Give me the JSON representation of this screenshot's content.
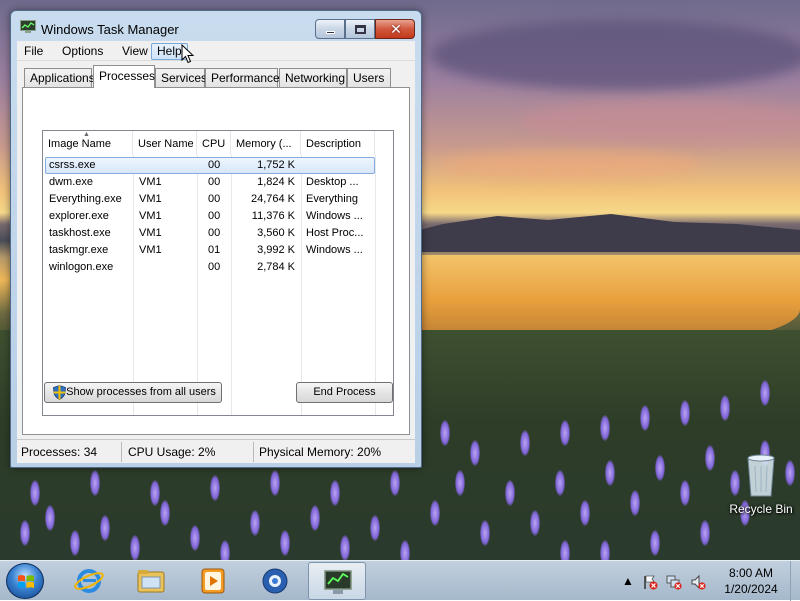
{
  "window": {
    "title": "Windows Task Manager",
    "close_glyph": "✕"
  },
  "menu": {
    "items": [
      "File",
      "Options",
      "View",
      "Help"
    ]
  },
  "tabs": [
    "Applications",
    "Processes",
    "Services",
    "Performance",
    "Networking",
    "Users"
  ],
  "active_tab": "Processes",
  "table": {
    "columns": [
      "Image Name",
      "User Name",
      "CPU",
      "Memory (...",
      "Description"
    ],
    "sort_arrow": "▲",
    "rows": [
      {
        "image": "csrss.exe",
        "user": "",
        "cpu": "00",
        "memory": "1,752 K",
        "description": ""
      },
      {
        "image": "dwm.exe",
        "user": "VM1",
        "cpu": "00",
        "memory": "1,824 K",
        "description": "Desktop ..."
      },
      {
        "image": "Everything.exe",
        "user": "VM1",
        "cpu": "00",
        "memory": "24,764 K",
        "description": "Everything"
      },
      {
        "image": "explorer.exe",
        "user": "VM1",
        "cpu": "00",
        "memory": "11,376 K",
        "description": "Windows ..."
      },
      {
        "image": "taskhost.exe",
        "user": "VM1",
        "cpu": "00",
        "memory": "3,560 K",
        "description": "Host Proc..."
      },
      {
        "image": "taskmgr.exe",
        "user": "VM1",
        "cpu": "01",
        "memory": "3,992 K",
        "description": "Windows ..."
      },
      {
        "image": "winlogon.exe",
        "user": "",
        "cpu": "00",
        "memory": "2,784 K",
        "description": ""
      }
    ],
    "selected_row": 0
  },
  "buttons": {
    "show_all": "Show processes from all users",
    "end_process": "End Process"
  },
  "status": {
    "processes": "Processes: 34",
    "cpu": "CPU Usage: 2%",
    "memory": "Physical Memory: 20%"
  },
  "desktop": {
    "recycle_bin_label": "Recycle Bin"
  },
  "taskbar": {
    "pinned": [
      "internet-explorer-icon",
      "windows-explorer-icon",
      "media-player-icon",
      "browser-icon",
      "task-manager-icon"
    ],
    "tray_arrow": "▲",
    "clock_time": "8:00 AM",
    "clock_date": "1/20/2024"
  },
  "colors": {
    "selection": "#d7e7fa",
    "close_button": "#c23a1d",
    "window_frame": "#b8cfe6"
  }
}
